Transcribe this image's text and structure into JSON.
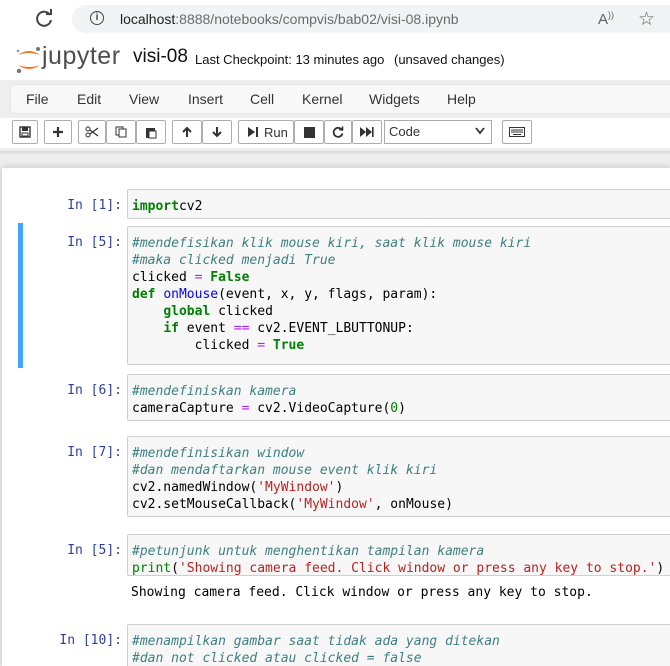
{
  "browser": {
    "url_host": "localhost",
    "url_rest": ":8888/notebooks/compvis/bab02/visi-08.ipynb"
  },
  "header": {
    "logo_text": "jupyter",
    "notebook_name": "visi-08",
    "checkpoint": "Last Checkpoint: 13 minutes ago",
    "unsaved": "(unsaved changes)"
  },
  "menu": [
    "File",
    "Edit",
    "View",
    "Insert",
    "Cell",
    "Kernel",
    "Widgets",
    "Help"
  ],
  "toolbar": {
    "run_label": "Run",
    "cell_type": "Code"
  },
  "cells": [
    {
      "prompt": "In [1]:",
      "lines": [
        [
          [
            "kw",
            "import"
          ],
          [
            "",
            "cv2"
          ]
        ]
      ]
    },
    {
      "prompt": "In [5]:",
      "selected": true,
      "lines": [
        [
          [
            "cm",
            "#mendefisikan klik mouse kiri, saat klik mouse kiri"
          ]
        ],
        [
          [
            "cm",
            "#maka clicked menjadi True"
          ]
        ],
        [
          [
            "",
            "clicked "
          ],
          [
            "op",
            "="
          ],
          [
            "",
            ""
          ],
          [
            "kw",
            " False"
          ]
        ],
        [
          [
            "kw",
            "def"
          ],
          [
            "",
            " "
          ],
          [
            "fn",
            "onMouse"
          ],
          [
            "",
            "(event, x, y, flags, param):"
          ]
        ],
        [
          [
            "",
            "    "
          ],
          [
            "kw",
            "global"
          ],
          [
            "",
            " clicked"
          ]
        ],
        [
          [
            "",
            "    "
          ],
          [
            "kw",
            "if"
          ],
          [
            "",
            " event "
          ],
          [
            "op",
            "=="
          ],
          [
            "",
            " cv2.EVENT_LBUTTONUP:"
          ]
        ],
        [
          [
            "",
            "        clicked "
          ],
          [
            "op",
            "="
          ],
          [
            "kw",
            " True"
          ]
        ]
      ]
    },
    {
      "prompt": "In [6]:",
      "lines": [
        [
          [
            "cm",
            "#mendefiniskan kamera"
          ]
        ],
        [
          [
            "",
            "cameraCapture "
          ],
          [
            "op",
            "="
          ],
          [
            "",
            " cv2.VideoCapture("
          ],
          [
            "num",
            "0"
          ],
          [
            "",
            ")"
          ]
        ]
      ]
    },
    {
      "prompt": "In [7]:",
      "lines": [
        [
          [
            "cm",
            "#mendefinisikan window"
          ]
        ],
        [
          [
            "cm",
            "#dan mendaftarkan mouse event klik kiri"
          ]
        ],
        [
          [
            "",
            "cv2.namedWindow("
          ],
          [
            "str",
            "'MyWindow'"
          ],
          [
            "",
            ")"
          ]
        ],
        [
          [
            "",
            "cv2.setMouseCallback("
          ],
          [
            "str",
            "'MyWindow'"
          ],
          [
            "",
            ", onMouse)"
          ]
        ]
      ]
    },
    {
      "prompt": "In [5]:",
      "lines": [
        [
          [
            "cm",
            "#petunjunk untuk menghentikan tampilan kamera"
          ]
        ],
        [
          [
            "kw2",
            "print"
          ],
          [
            "",
            "("
          ],
          [
            "str",
            "'Showing camera feed. Click window or press any key to stop.'"
          ],
          [
            "",
            ")"
          ]
        ]
      ],
      "output": "Showing camera feed. Click window or press any key to stop."
    },
    {
      "prompt": "In [10]:",
      "lines": [
        [
          [
            "cm",
            "#menampilkan gambar saat tidak ada yang ditekan"
          ]
        ],
        [
          [
            "cm",
            "#dan not clicked atau clicked = false"
          ]
        ]
      ]
    }
  ]
}
